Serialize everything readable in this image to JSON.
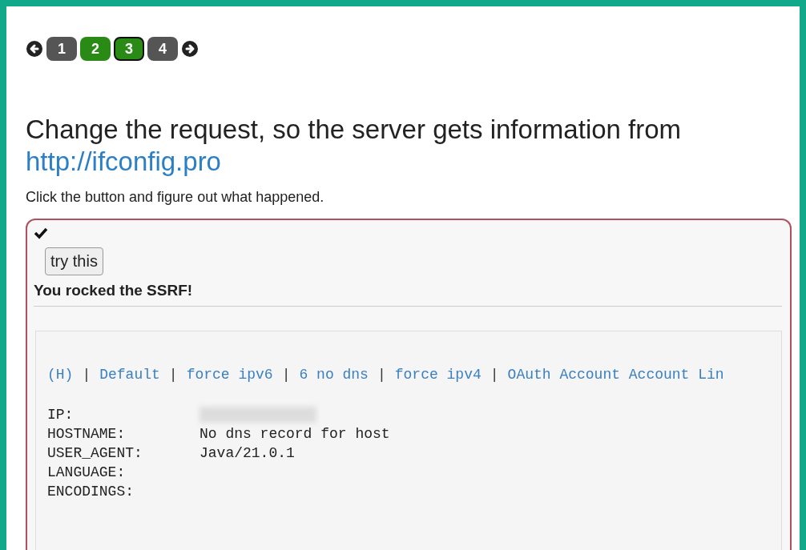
{
  "pager": {
    "pages": [
      {
        "label": "1",
        "solved": false,
        "selected": false
      },
      {
        "label": "2",
        "solved": true,
        "selected": false
      },
      {
        "label": "3",
        "solved": true,
        "selected": true
      },
      {
        "label": "4",
        "solved": false,
        "selected": false
      }
    ]
  },
  "heading": {
    "text": "Change the request, so the server gets information from",
    "link": "http://ifconfig.pro"
  },
  "instruction": "Click the button and figure out what happened.",
  "assignment": {
    "solved": true,
    "button": "try this",
    "feedback": "You rocked the SSRF!",
    "output": {
      "links": [
        "(H)",
        "Default",
        "force ipv6",
        "6 no dns",
        "force ipv4",
        "OAuth Account Account Lin"
      ],
      "separator": "|",
      "rows": [
        {
          "key": "IP:",
          "redacted": true
        },
        {
          "key": "HOSTNAME:",
          "value": "No dns record for host",
          "redacted": false
        },
        {
          "key": "USER_AGENT:",
          "value": "Java/21.0.1",
          "redacted": false
        },
        {
          "key": "LANGUAGE:",
          "redacted": false
        },
        {
          "key": "ENCODINGS:",
          "redacted": false
        }
      ]
    }
  }
}
